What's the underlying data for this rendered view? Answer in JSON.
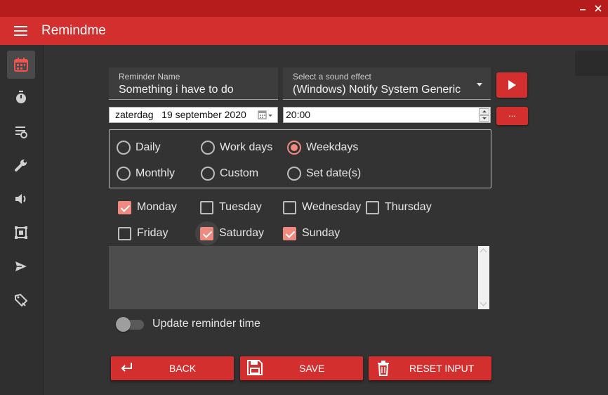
{
  "app": {
    "title": "Remindme"
  },
  "sidebar": {
    "items": [
      {
        "name": "calendar",
        "active": true
      },
      {
        "name": "timer",
        "active": false
      },
      {
        "name": "list-settings",
        "active": false
      },
      {
        "name": "wrench",
        "active": false
      },
      {
        "name": "volume",
        "active": false
      },
      {
        "name": "resize",
        "active": false
      },
      {
        "name": "send",
        "active": false
      },
      {
        "name": "tag",
        "active": false
      }
    ]
  },
  "form": {
    "reminder_name": {
      "label": "Reminder Name",
      "value": "Something i have to do"
    },
    "sound": {
      "label": "Select a sound effect",
      "value": "(Windows) Notify System Generic"
    },
    "date": {
      "value": "zaterdag   19 september 2020"
    },
    "time": {
      "value": "20:00"
    },
    "more_label": "...",
    "repeat": {
      "options": [
        {
          "label": "Daily",
          "checked": false
        },
        {
          "label": "Work days",
          "checked": false
        },
        {
          "label": "Weekdays",
          "checked": true
        },
        {
          "label": "Monthly",
          "checked": false
        },
        {
          "label": "Custom",
          "checked": false
        },
        {
          "label": "Set date(s)",
          "checked": false
        }
      ]
    },
    "days": [
      {
        "label": "Monday",
        "checked": true
      },
      {
        "label": "Tuesday",
        "checked": false
      },
      {
        "label": "Wednesday",
        "checked": false
      },
      {
        "label": "Thursday",
        "checked": false
      },
      {
        "label": "Friday",
        "checked": false
      },
      {
        "label": "Saturday",
        "checked": true
      },
      {
        "label": "Sunday",
        "checked": true
      }
    ],
    "note": {
      "value": ""
    },
    "update_time": {
      "label": "Update reminder time",
      "on": false
    }
  },
  "actions": {
    "back": "BACK",
    "save": "SAVE",
    "reset": "RESET INPUT"
  },
  "colors": {
    "accent": "#d32f2f",
    "accent_dark": "#b71c1c",
    "check": "#ef8a80",
    "background": "#333333"
  }
}
